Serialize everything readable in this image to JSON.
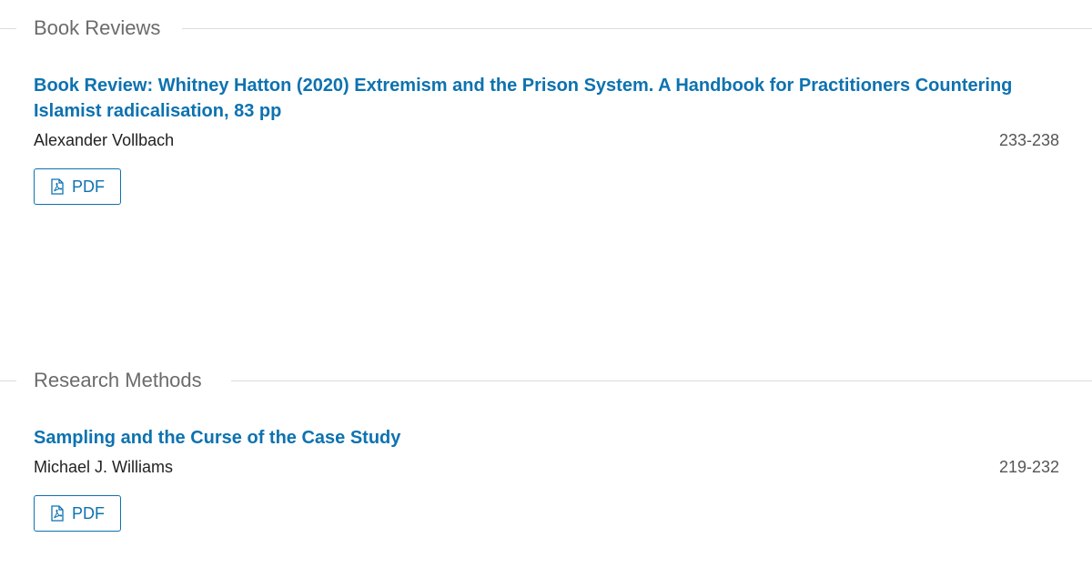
{
  "sections": [
    {
      "title": "Book Reviews",
      "articles": [
        {
          "title": "Book Review: Whitney Hatton (2020) Extremism and the Prison System. A Handbook for Practitioners Countering Islamist radicalisation, 83 pp",
          "author": "Alexander Vollbach",
          "pages": "233-238",
          "pdf_label": "PDF"
        }
      ]
    },
    {
      "title": "Research Methods",
      "articles": [
        {
          "title": "Sampling and the Curse of the Case Study",
          "author": "Michael J. Williams",
          "pages": "219-232",
          "pdf_label": "PDF"
        }
      ]
    }
  ],
  "icons": {
    "pdf_icon": "pdf-file-icon"
  },
  "colors": {
    "link": "#0d72b0",
    "section_title": "#6b6b6b",
    "divider": "#dcdcdc"
  }
}
